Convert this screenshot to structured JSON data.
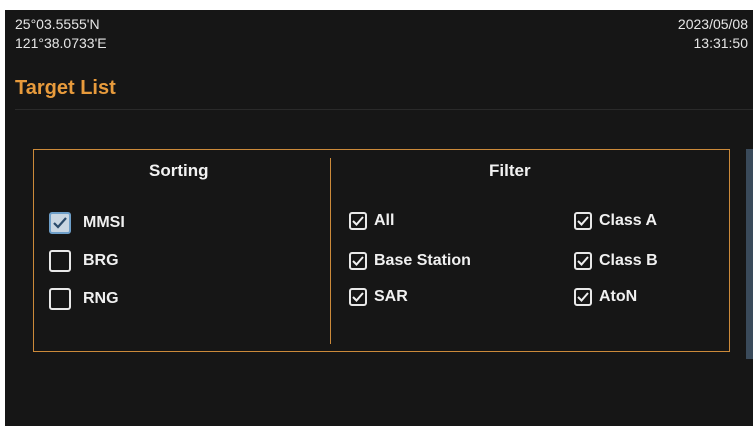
{
  "header": {
    "latitude": "25°03.5555'N",
    "longitude": "121°38.0733'E",
    "date": "2023/05/08",
    "time": "13:31:50"
  },
  "page_title": "Target List",
  "sorting": {
    "title": "Sorting",
    "options": [
      {
        "label": "MMSI",
        "checked": true,
        "selected": true
      },
      {
        "label": "BRG",
        "checked": false
      },
      {
        "label": "RNG",
        "checked": false
      }
    ]
  },
  "filter": {
    "title": "Filter",
    "options": [
      {
        "label": "All",
        "checked": true
      },
      {
        "label": "Base Station",
        "checked": true
      },
      {
        "label": "SAR",
        "checked": true
      },
      {
        "label": "Class A",
        "checked": true
      },
      {
        "label": "Class B",
        "checked": true
      },
      {
        "label": "AtoN",
        "checked": true
      }
    ]
  },
  "colors": {
    "accent": "#e89b3c",
    "background": "#161616",
    "border": "#cc8a3a",
    "selection": "#6e9fc9"
  }
}
